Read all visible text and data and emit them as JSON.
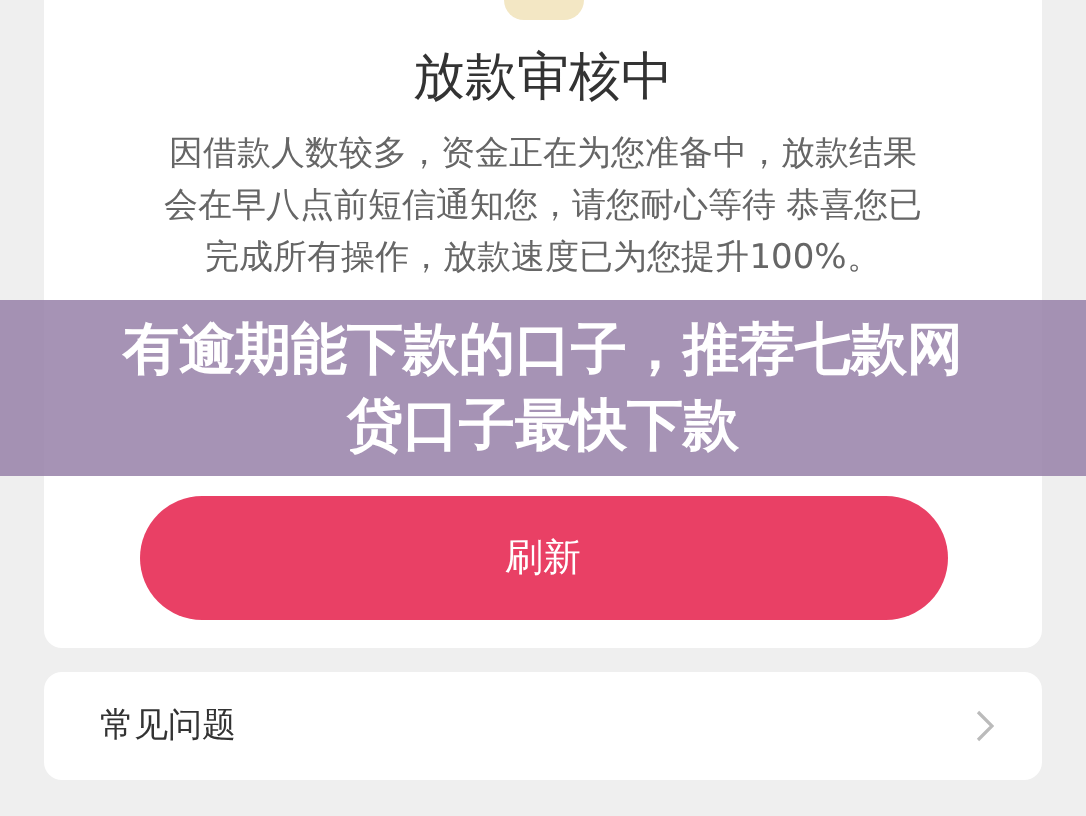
{
  "status": {
    "title": "放款审核中",
    "message": "因借款人数较多，资金正在为您准备中，放款结果会在早八点前短信通知您，请您耐心等待 恭喜您已完成所有操作，放款速度已为您提升100%。",
    "button": "刷新"
  },
  "faq": {
    "label": "常见问题"
  },
  "headline": {
    "text": "有逾期能下款的口子，推荐七款网贷口子最快下款"
  }
}
